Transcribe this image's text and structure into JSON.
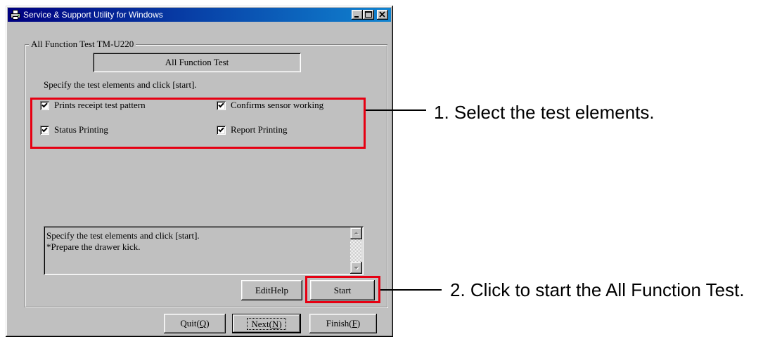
{
  "colors": {
    "title_bar_start": "#000080",
    "title_bar_end": "#1084d0",
    "face": "#c0c0c0",
    "highlight": "#e60012",
    "callout_ink": "#000000"
  },
  "window": {
    "title": "Service & Support Utility for Windows",
    "icons": {
      "app": "app-icon",
      "minimize": "minimize-icon",
      "maximize": "maximize-icon",
      "close": "close-icon",
      "checkmark": "checkmark-icon",
      "scroll_up": "scroll-up-arrow-icon",
      "scroll_down": "scroll-down-arrow-icon"
    }
  },
  "test_panel": {
    "group_label": "All Function Test TM-U220",
    "heading": "All Function Test",
    "instruction": "Specify the test elements and click [start].",
    "checkboxes": [
      {
        "label": "Prints receipt test pattern",
        "checked": true
      },
      {
        "label": "Confirms sensor working",
        "checked": true
      },
      {
        "label": "Status Printing",
        "checked": true
      },
      {
        "label": "Report Printing",
        "checked": true
      }
    ],
    "message_lines": [
      "Specify the test elements and click [start].",
      "*Prepare the drawer kick."
    ],
    "edit_help_button": "EditHelp",
    "start_button": "Start"
  },
  "footer": {
    "quit_button": "Quit(Q)",
    "next_button": "Next(N)",
    "finish_button": "Finish(F)"
  },
  "callouts": [
    {
      "text": "1. Select the test elements."
    },
    {
      "text": "2. Click to start the All Function Test."
    }
  ]
}
